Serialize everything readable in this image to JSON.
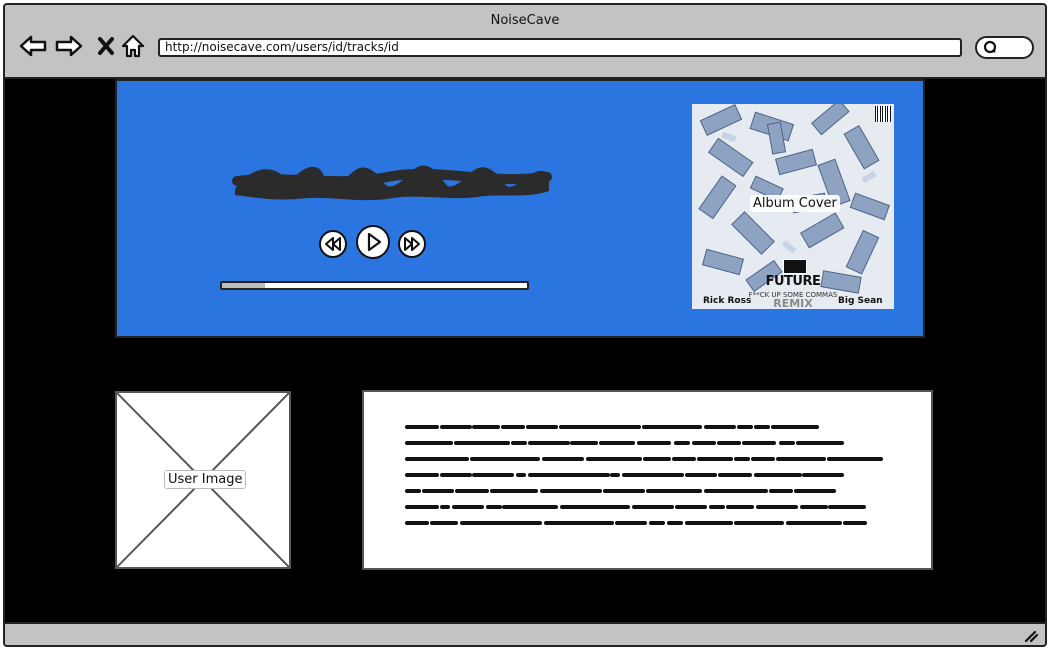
{
  "window": {
    "title": "NoiseCave",
    "url": "http://noisecave.com/users/id/tracks/id"
  },
  "nav": {
    "back_icon": "back-arrow-icon",
    "forward_icon": "forward-arrow-icon",
    "stop_icon": "close-icon",
    "home_icon": "home-icon",
    "search_icon": "search-icon"
  },
  "player": {
    "background_color": "#2a75e0",
    "progress_fraction": 0.14,
    "controls": {
      "rewind_icon": "rewind-icon",
      "play_icon": "play-icon",
      "fast_forward_icon": "fast-forward-icon"
    },
    "album_cover": {
      "label": "Album Cover",
      "artist_text": "FUTURE",
      "subtitle_text": "F**CK UP SOME COMMAS",
      "remix_text": "REMIX",
      "left_credit": "Rick Ross",
      "right_credit": "Big Sean"
    }
  },
  "user_image": {
    "label": "User Image"
  },
  "colors": {
    "chrome": "#c3c3c3",
    "page_background": "#000000",
    "player_accent": "#2a75e0"
  }
}
